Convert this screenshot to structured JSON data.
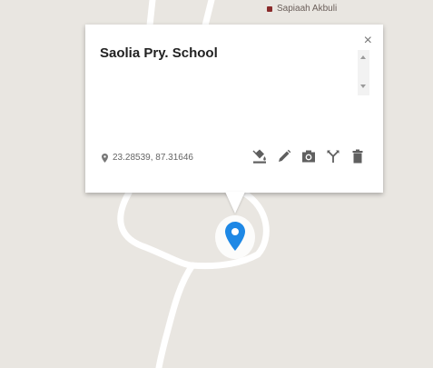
{
  "map": {
    "poi_label": "Sapiaah Akbuli",
    "background_color": "#e9e6e1",
    "road_color": "#ffffff"
  },
  "info_card": {
    "title": "Saolia Pry. School",
    "coordinates": "23.28539, 87.31646",
    "close_symbol": "×",
    "tools": [
      {
        "icon": "paint-bucket-icon",
        "action": "style"
      },
      {
        "icon": "pencil-icon",
        "action": "edit"
      },
      {
        "icon": "camera-icon",
        "action": "add-photo"
      },
      {
        "icon": "directions-icon",
        "action": "directions"
      },
      {
        "icon": "trash-icon",
        "action": "delete"
      }
    ]
  },
  "marker": {
    "icon": "map-pin-icon",
    "color": "#1e88e5"
  }
}
